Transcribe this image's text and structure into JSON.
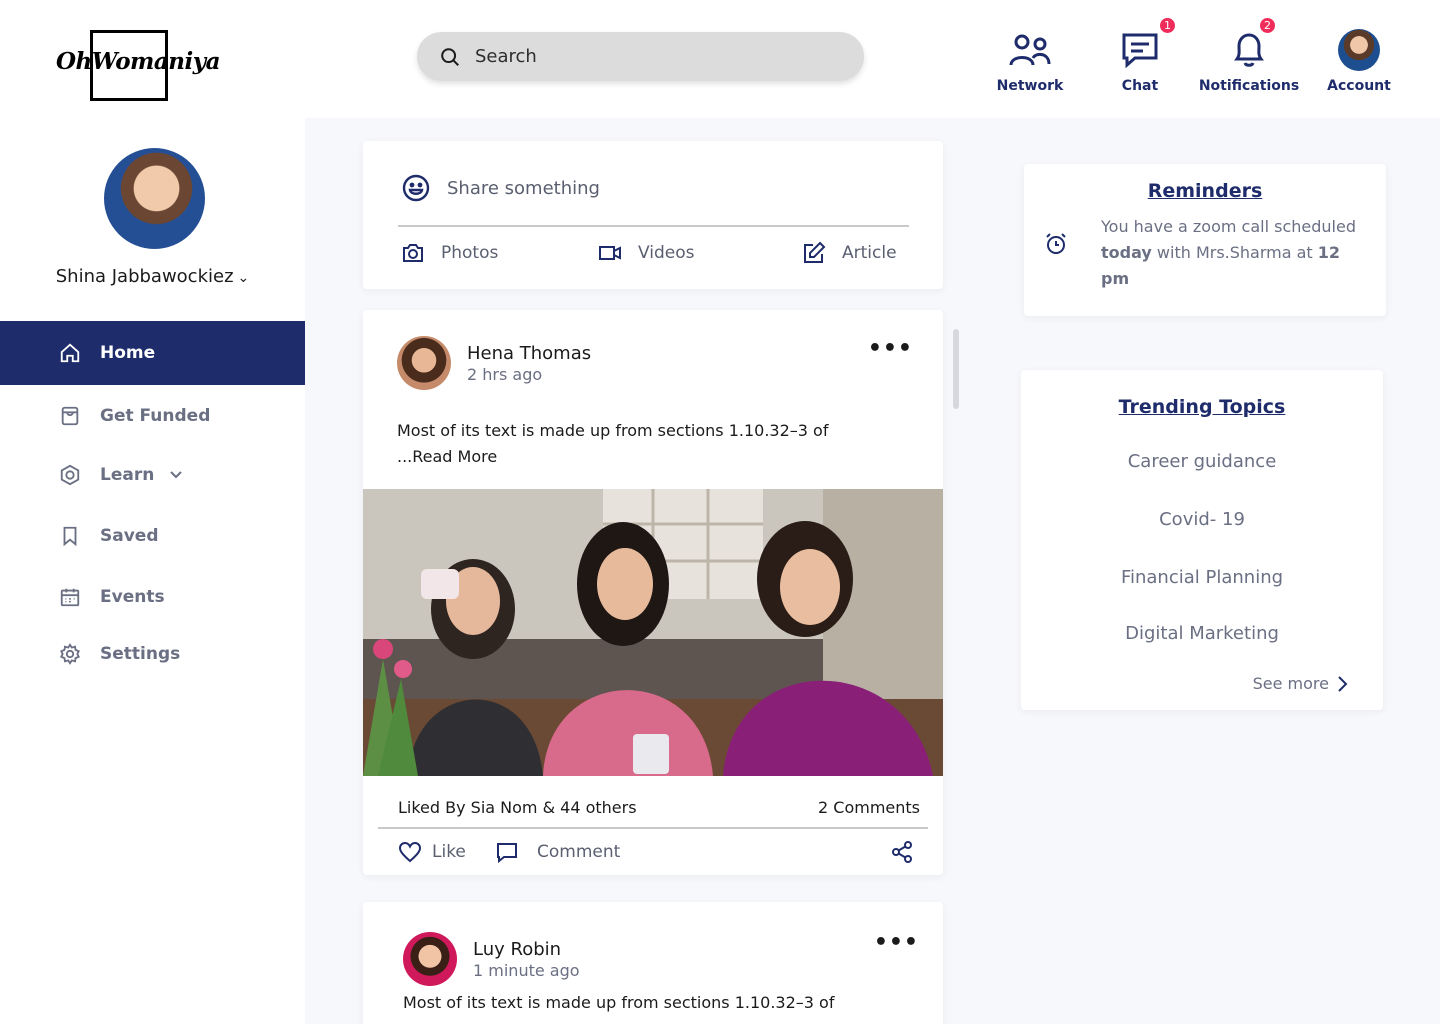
{
  "brand": {
    "logo_text": "OhWomaniya"
  },
  "search": {
    "placeholder": "Search"
  },
  "nav": {
    "network": "Network",
    "chat": "Chat",
    "chat_badge": "1",
    "notifications": "Notifications",
    "notifications_badge": "2",
    "account": "Account"
  },
  "profile": {
    "name": "Shina Jabbawockiez"
  },
  "sidebar": {
    "items": [
      {
        "label": "Home",
        "icon": "home-icon"
      },
      {
        "label": "Get Funded",
        "icon": "wallet-icon"
      },
      {
        "label": "Learn",
        "icon": "learn-icon"
      },
      {
        "label": "Saved",
        "icon": "bookmark-icon"
      },
      {
        "label": "Events",
        "icon": "calendar-icon"
      },
      {
        "label": "Settings",
        "icon": "gear-icon"
      }
    ]
  },
  "composer": {
    "placeholder": "Share something",
    "photos": "Photos",
    "videos": "Videos",
    "article": "Article"
  },
  "posts": [
    {
      "author": "Hena Thomas",
      "time": "2 hrs ago",
      "text_line1": "Most of its text is made up from sections 1.10.32–3 of",
      "text_line2": "...Read More",
      "likes": "Liked By Sia Nom & 44 others",
      "comments": "2 Comments",
      "like_label": "Like",
      "comment_label": "Comment"
    },
    {
      "author": "Luy Robin",
      "time": "1 minute ago",
      "text_line1": "Most of its text is made up from sections 1.10.32–3 of"
    }
  ],
  "reminders": {
    "title": "Reminders",
    "text_a": "You have a zoom call scheduled ",
    "bold_a": "today",
    "text_b": " with Mrs.Sharma at ",
    "bold_b": "12 pm"
  },
  "trending": {
    "title": "Trending Topics",
    "topics": [
      "Career guidance",
      "Covid- 19",
      "Financial Planning",
      "Digital Marketing"
    ],
    "see_more": "See more"
  },
  "colors": {
    "primary": "#1f2c6b",
    "badge": "#f02d5a",
    "muted": "#6a6f83"
  }
}
